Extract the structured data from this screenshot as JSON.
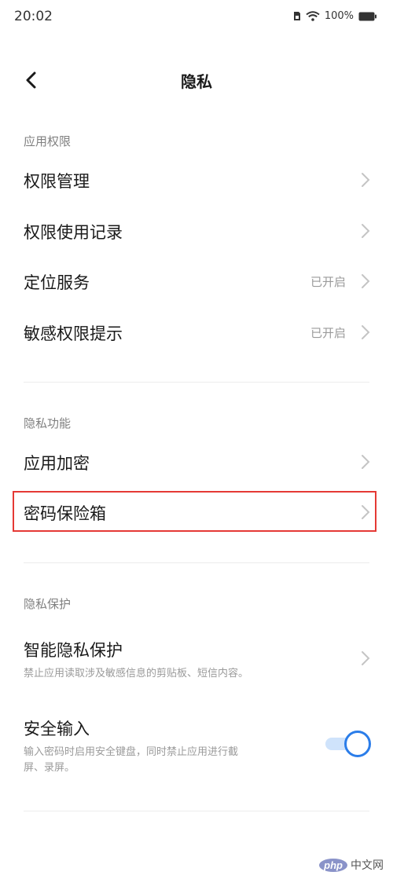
{
  "status_bar": {
    "time": "20:02",
    "battery": "100%"
  },
  "nav": {
    "title": "隐私"
  },
  "sections": {
    "app_permissions": {
      "header": "应用权限",
      "items": [
        {
          "title": "权限管理",
          "value": ""
        },
        {
          "title": "权限使用记录",
          "value": ""
        },
        {
          "title": "定位服务",
          "value": "已开启"
        },
        {
          "title": "敏感权限提示",
          "value": "已开启"
        }
      ]
    },
    "privacy_functions": {
      "header": "隐私功能",
      "items": [
        {
          "title": "应用加密"
        },
        {
          "title": "密码保险箱"
        }
      ]
    },
    "privacy_protection": {
      "header": "隐私保护",
      "smart_protection": {
        "title": "智能隐私保护",
        "desc": "禁止应用读取涉及敏感信息的剪贴板、短信内容。"
      },
      "secure_input": {
        "title": "安全输入",
        "desc_line1": "输入密码时启用安全键盘，同时禁止应用进行截",
        "desc_line2": "屏、录屏。",
        "enabled": true
      }
    }
  },
  "colors": {
    "accent": "#2b7de9",
    "highlight": "#e53935"
  },
  "watermark": {
    "badge": "php",
    "site": "中文网"
  }
}
